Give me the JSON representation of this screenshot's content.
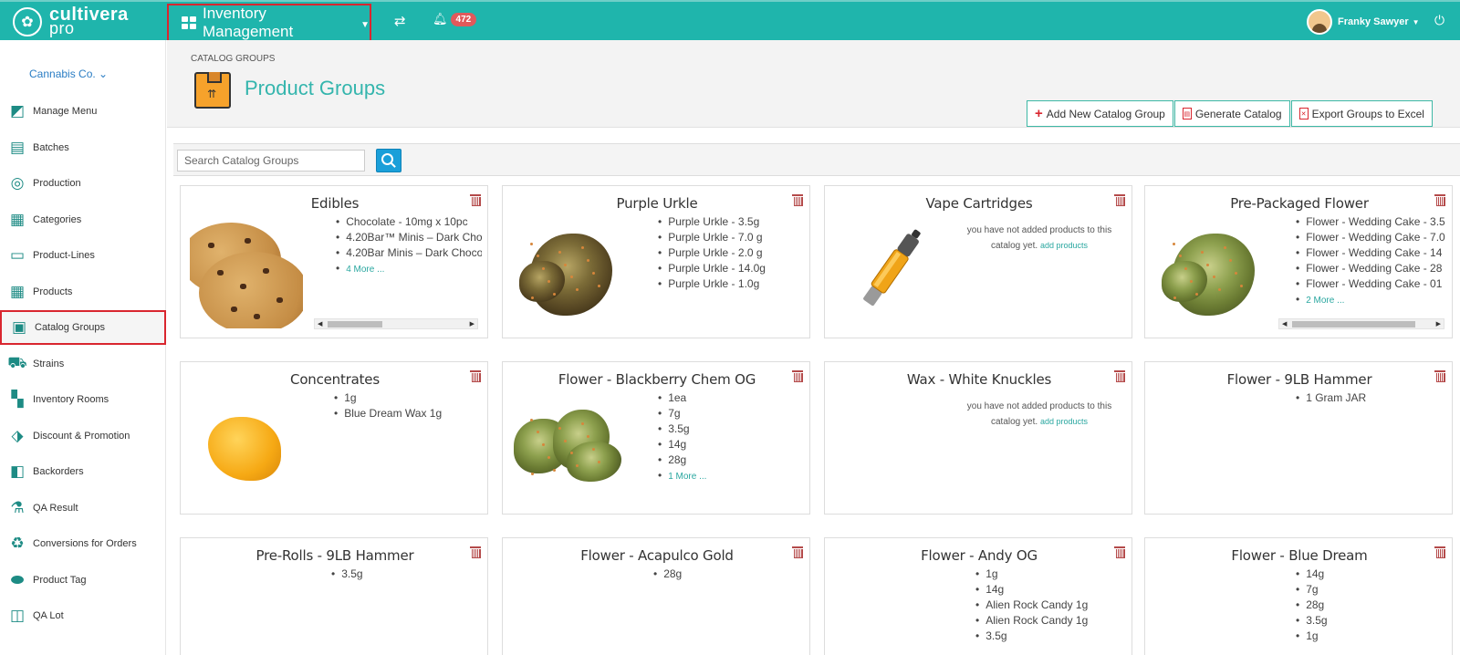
{
  "app": {
    "logo_line1": "cultivera",
    "logo_line2": "pro",
    "module": "Inventory Management",
    "notification_count": "472",
    "user_name": "Franky Sawyer"
  },
  "sidebar": {
    "company": "Cannabis Co. ⌄",
    "items": [
      {
        "label": "Manage Menu",
        "icon": "menu-book-icon"
      },
      {
        "label": "Batches",
        "icon": "batches-icon"
      },
      {
        "label": "Production",
        "icon": "production-icon"
      },
      {
        "label": "Categories",
        "icon": "categories-icon"
      },
      {
        "label": "Product-Lines",
        "icon": "product-lines-icon"
      },
      {
        "label": "Products",
        "icon": "products-grid-icon"
      },
      {
        "label": "Catalog Groups",
        "icon": "catalog-groups-icon"
      },
      {
        "label": "Strains",
        "icon": "strains-icon"
      },
      {
        "label": "Inventory Rooms",
        "icon": "inventory-rooms-icon"
      },
      {
        "label": "Discount & Promotion",
        "icon": "tags-icon"
      },
      {
        "label": "Backorders",
        "icon": "backorders-icon"
      },
      {
        "label": "QA Result",
        "icon": "flask-icon"
      },
      {
        "label": "Conversions for Orders",
        "icon": "recycle-icon"
      },
      {
        "label": "Product Tag",
        "icon": "tag-icon"
      },
      {
        "label": "QA Lot",
        "icon": "qa-lot-icon"
      }
    ]
  },
  "header": {
    "breadcrumb": "CATALOG GROUPS",
    "title": "Product Groups",
    "buttons": {
      "add": "Add New Catalog Group",
      "generate": "Generate Catalog",
      "export": "Export Groups to Excel"
    }
  },
  "search": {
    "placeholder": "Search Catalog Groups",
    "value": ""
  },
  "cards": [
    {
      "title": "Edibles",
      "items": [
        "Chocolate - 10mg x 10pc",
        "4.20Bar™ Minis – Dark Cho",
        "4.20Bar Minis – Dark Choco"
      ],
      "more": "4 More ..."
    },
    {
      "title": "Purple Urkle",
      "items": [
        "Purple Urkle - 3.5g",
        "Purple Urkle - 7.0 g",
        "Purple Urkle - 2.0 g",
        "Purple Urkle - 14.0g",
        "Purple Urkle - 1.0g"
      ]
    },
    {
      "title": "Vape Cartridges",
      "empty": "you have not added products to this catalog yet.",
      "add_link": "add products"
    },
    {
      "title": "Pre-Packaged Flower",
      "items": [
        "Flower - Wedding Cake - 3.5",
        "Flower - Wedding Cake - 7.0",
        "Flower - Wedding Cake - 14",
        "Flower - Wedding Cake - 28",
        "Flower - Wedding Cake - 01"
      ],
      "more": "2 More ..."
    },
    {
      "title": "Concentrates",
      "items": [
        "1g",
        "Blue Dream Wax 1g"
      ]
    },
    {
      "title": "Flower - Blackberry Chem OG",
      "items": [
        "1ea",
        "7g",
        "3.5g",
        "14g",
        "28g"
      ],
      "more": "1 More ..."
    },
    {
      "title": "Wax - White Knuckles",
      "empty": "you have not added products to this catalog yet.",
      "add_link": "add products"
    },
    {
      "title": "Flower - 9LB Hammer",
      "items": [
        "1 Gram JAR"
      ]
    },
    {
      "title": "Pre-Rolls - 9LB Hammer",
      "items": [
        "3.5g"
      ]
    },
    {
      "title": "Flower - Acapulco Gold",
      "items": [
        "28g"
      ]
    },
    {
      "title": "Flower - Andy OG",
      "items": [
        "1g",
        "14g",
        "Alien Rock Candy 1g",
        "Alien Rock Candy 1g",
        "3.5g"
      ]
    },
    {
      "title": "Flower - Blue Dream",
      "items": [
        "14g",
        "7g",
        "28g",
        "3.5g",
        "1g"
      ]
    }
  ]
}
